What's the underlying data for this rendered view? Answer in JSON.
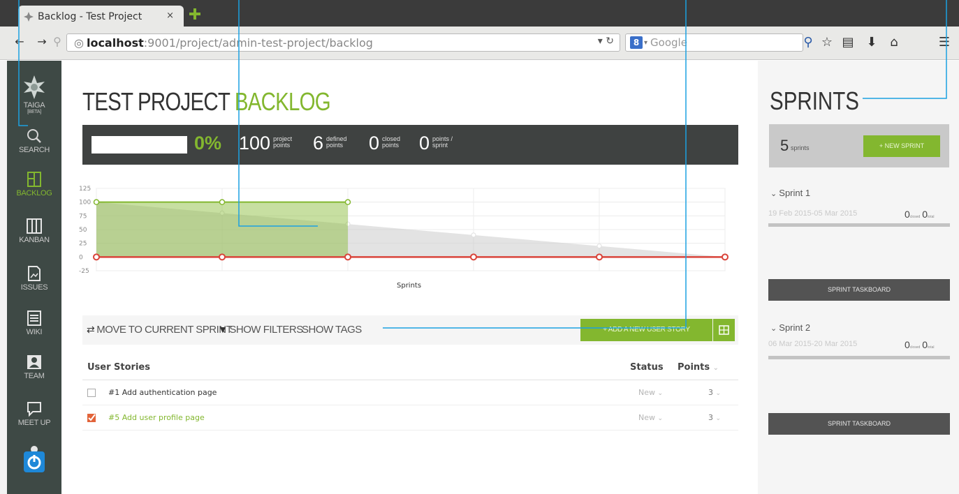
{
  "browser": {
    "tab_title": "Backlog - Test Project",
    "tab_close": "×",
    "url_host": "localhost",
    "url_rest": ":9001/project/admin-test-project/backlog",
    "search_engine_badge": "8",
    "search_placeholder": "Google"
  },
  "sidebar": {
    "logo_label": "TAIGA",
    "logo_sub": "[BETA]",
    "items": [
      {
        "label": "SEARCH",
        "icon": "search-icon"
      },
      {
        "label": "BACKLOG",
        "icon": "backlog-icon"
      },
      {
        "label": "KANBAN",
        "icon": "kanban-icon"
      },
      {
        "label": "ISSUES",
        "icon": "issues-icon"
      },
      {
        "label": "WIKI",
        "icon": "wiki-icon"
      },
      {
        "label": "TEAM",
        "icon": "team-icon"
      },
      {
        "label": "MEET UP",
        "icon": "meetup-icon"
      }
    ]
  },
  "header": {
    "title_main": "TEST PROJECT",
    "title_accent": "BACKLOG"
  },
  "stats": {
    "progress_fraction": 0,
    "percent": "0%",
    "project_points": "100",
    "project_points_label": "project\npoints",
    "defined_points": "6",
    "defined_points_label": "defined\npoints",
    "closed_points": "0",
    "closed_points_label": "closed\npoints",
    "points_per_sprint": "0",
    "points_per_sprint_label": "points /\nsprint"
  },
  "chart_data": {
    "type": "area",
    "xlabel": "Sprints",
    "ylabel": "",
    "ylim": [
      -25,
      125
    ],
    "yticks": [
      125,
      100,
      75,
      50,
      25,
      0,
      -25
    ],
    "x": [
      0,
      1,
      2,
      3,
      4,
      5
    ],
    "series": [
      {
        "name": "",
        "color": "#83b72f",
        "values": [
          100,
          100,
          100,
          null,
          null,
          null
        ]
      },
      {
        "name": "",
        "color": "#cccccc",
        "values": [
          100,
          80,
          60,
          40,
          20,
          0
        ]
      },
      {
        "name": "",
        "color": "#d9443a",
        "values": [
          0,
          0,
          0,
          0,
          0,
          0
        ]
      }
    ],
    "grid": true
  },
  "toolbar": {
    "move_sprint": "MOVE TO CURRENT SPRINT",
    "show_filters": "SHOW FILTERS",
    "show_tags": "SHOW TAGS",
    "add_story": "+ ADD A NEW USER STORY"
  },
  "table": {
    "col_stories": "User Stories",
    "col_status": "Status",
    "col_points": "Points",
    "rows": [
      {
        "title": "#1 Add authentication page",
        "status": "New",
        "points": "3",
        "checked": false
      },
      {
        "title": "#5 Add user profile page",
        "status": "New",
        "points": "3",
        "checked": true
      }
    ]
  },
  "sprints": {
    "title": "SPRINTS",
    "count": "5",
    "count_label": "sprints",
    "new_sprint": "+ NEW SPRINT",
    "items": [
      {
        "name": "Sprint 1",
        "dates": "19 Feb 2015-05 Mar 2015",
        "closed": "0",
        "closed_label": "closed",
        "total": "0",
        "total_label": "total",
        "taskboard": "SPRINT TASKBOARD"
      },
      {
        "name": "Sprint 2",
        "dates": "06 Mar 2015-20 Mar 2015",
        "closed": "0",
        "closed_label": "closed",
        "total": "0",
        "total_label": "total",
        "taskboard": "SPRINT TASKBOARD"
      }
    ]
  },
  "colors": {
    "accent": "#83b72f",
    "sidebar": "#3e4945",
    "dark_bar": "#3f4241",
    "callout": "#1ba1e2"
  }
}
